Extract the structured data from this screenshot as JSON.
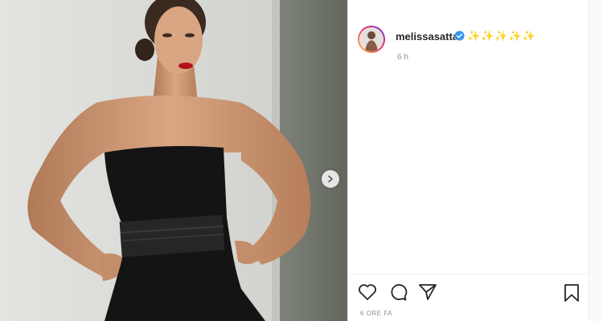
{
  "post": {
    "username": "melissasatta",
    "caption": "✨✨✨✨✨",
    "time_ago": "6 h",
    "date_label": "6 ORE FA"
  },
  "icons": {
    "verified": "verified-badge-icon",
    "next": "chevron-right-icon",
    "like": "heart-icon",
    "comment": "comment-icon",
    "share": "paper-plane-icon",
    "save": "bookmark-icon"
  },
  "colors": {
    "verified_blue": "#3897f0",
    "text_primary": "#262626",
    "text_secondary": "#8e8e8e"
  }
}
